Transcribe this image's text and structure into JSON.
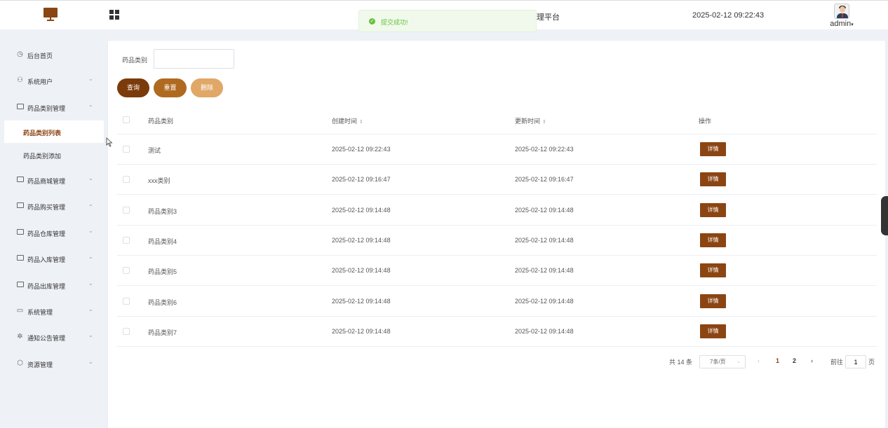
{
  "header": {
    "platform_title": "理平台",
    "datetime": "2025-02-12 09:22:43",
    "user_name": "admin",
    "user_caret": "▾"
  },
  "toast": {
    "message": "提交成功!",
    "icon": "check-circle-icon",
    "color": "#67c23a"
  },
  "sidebar": {
    "items": [
      {
        "label": "后台首页",
        "icon": "clock-icon",
        "arrow": ""
      },
      {
        "label": "系统用户",
        "icon": "user-icon",
        "arrow": "⌄"
      },
      {
        "label": "药品类别管理",
        "icon": "box-icon",
        "arrow": "⌃"
      },
      {
        "label": "药品商城管理",
        "icon": "box-icon",
        "arrow": "⌄"
      },
      {
        "label": "药品购买管理",
        "icon": "box-icon",
        "arrow": "⌄"
      },
      {
        "label": "药品仓库管理",
        "icon": "box-icon",
        "arrow": "⌄"
      },
      {
        "label": "药品入库管理",
        "icon": "box-icon",
        "arrow": "⌄"
      },
      {
        "label": "药品出库管理",
        "icon": "box-icon",
        "arrow": "⌄"
      },
      {
        "label": "系统管理",
        "icon": "folder-icon",
        "arrow": "⌄"
      },
      {
        "label": "通知公告管理",
        "icon": "sparkle-icon",
        "arrow": "⌄"
      },
      {
        "label": "资源管理",
        "icon": "cube-icon",
        "arrow": "⌄"
      }
    ],
    "sub_items": [
      {
        "label": "药品类别列表",
        "active": true
      },
      {
        "label": "药品类别添加",
        "active": false
      }
    ]
  },
  "search": {
    "label": "药品类别",
    "value": "",
    "placeholder": ""
  },
  "buttons": {
    "query": "查询",
    "reset": "重置",
    "delete": "删除"
  },
  "table": {
    "headers": {
      "category": "药品类别",
      "created": "创建时间",
      "updated": "更新时间",
      "actions": "操作"
    },
    "sort_icon": "⇕",
    "rows": [
      {
        "category": "测试",
        "created": "2025-02-12 09:22:43",
        "updated": "2025-02-12 09:22:43",
        "action": "详情"
      },
      {
        "category": "xxx类别",
        "created": "2025-02-12 09:16:47",
        "updated": "2025-02-12 09:16:47",
        "action": "详情"
      },
      {
        "category": "药品类别3",
        "created": "2025-02-12 09:14:48",
        "updated": "2025-02-12 09:14:48",
        "action": "详情"
      },
      {
        "category": "药品类别4",
        "created": "2025-02-12 09:14:48",
        "updated": "2025-02-12 09:14:48",
        "action": "详情"
      },
      {
        "category": "药品类别5",
        "created": "2025-02-12 09:14:48",
        "updated": "2025-02-12 09:14:48",
        "action": "详情"
      },
      {
        "category": "药品类别6",
        "created": "2025-02-12 09:14:48",
        "updated": "2025-02-12 09:14:48",
        "action": "详情"
      },
      {
        "category": "药品类别7",
        "created": "2025-02-12 09:14:48",
        "updated": "2025-02-12 09:14:48",
        "action": "详情"
      }
    ]
  },
  "pagination": {
    "total": "共 14 条",
    "page_size": "7条/页",
    "prev": "‹",
    "pages": [
      "1",
      "2"
    ],
    "current_page": "1",
    "next": "›",
    "goto_label": "前往",
    "goto_value": "1",
    "goto_suffix": "页"
  },
  "colors": {
    "brand": "#8b4513",
    "query": "#7b3b0b",
    "reset": "#b06a20",
    "delete": "#e0a767"
  }
}
